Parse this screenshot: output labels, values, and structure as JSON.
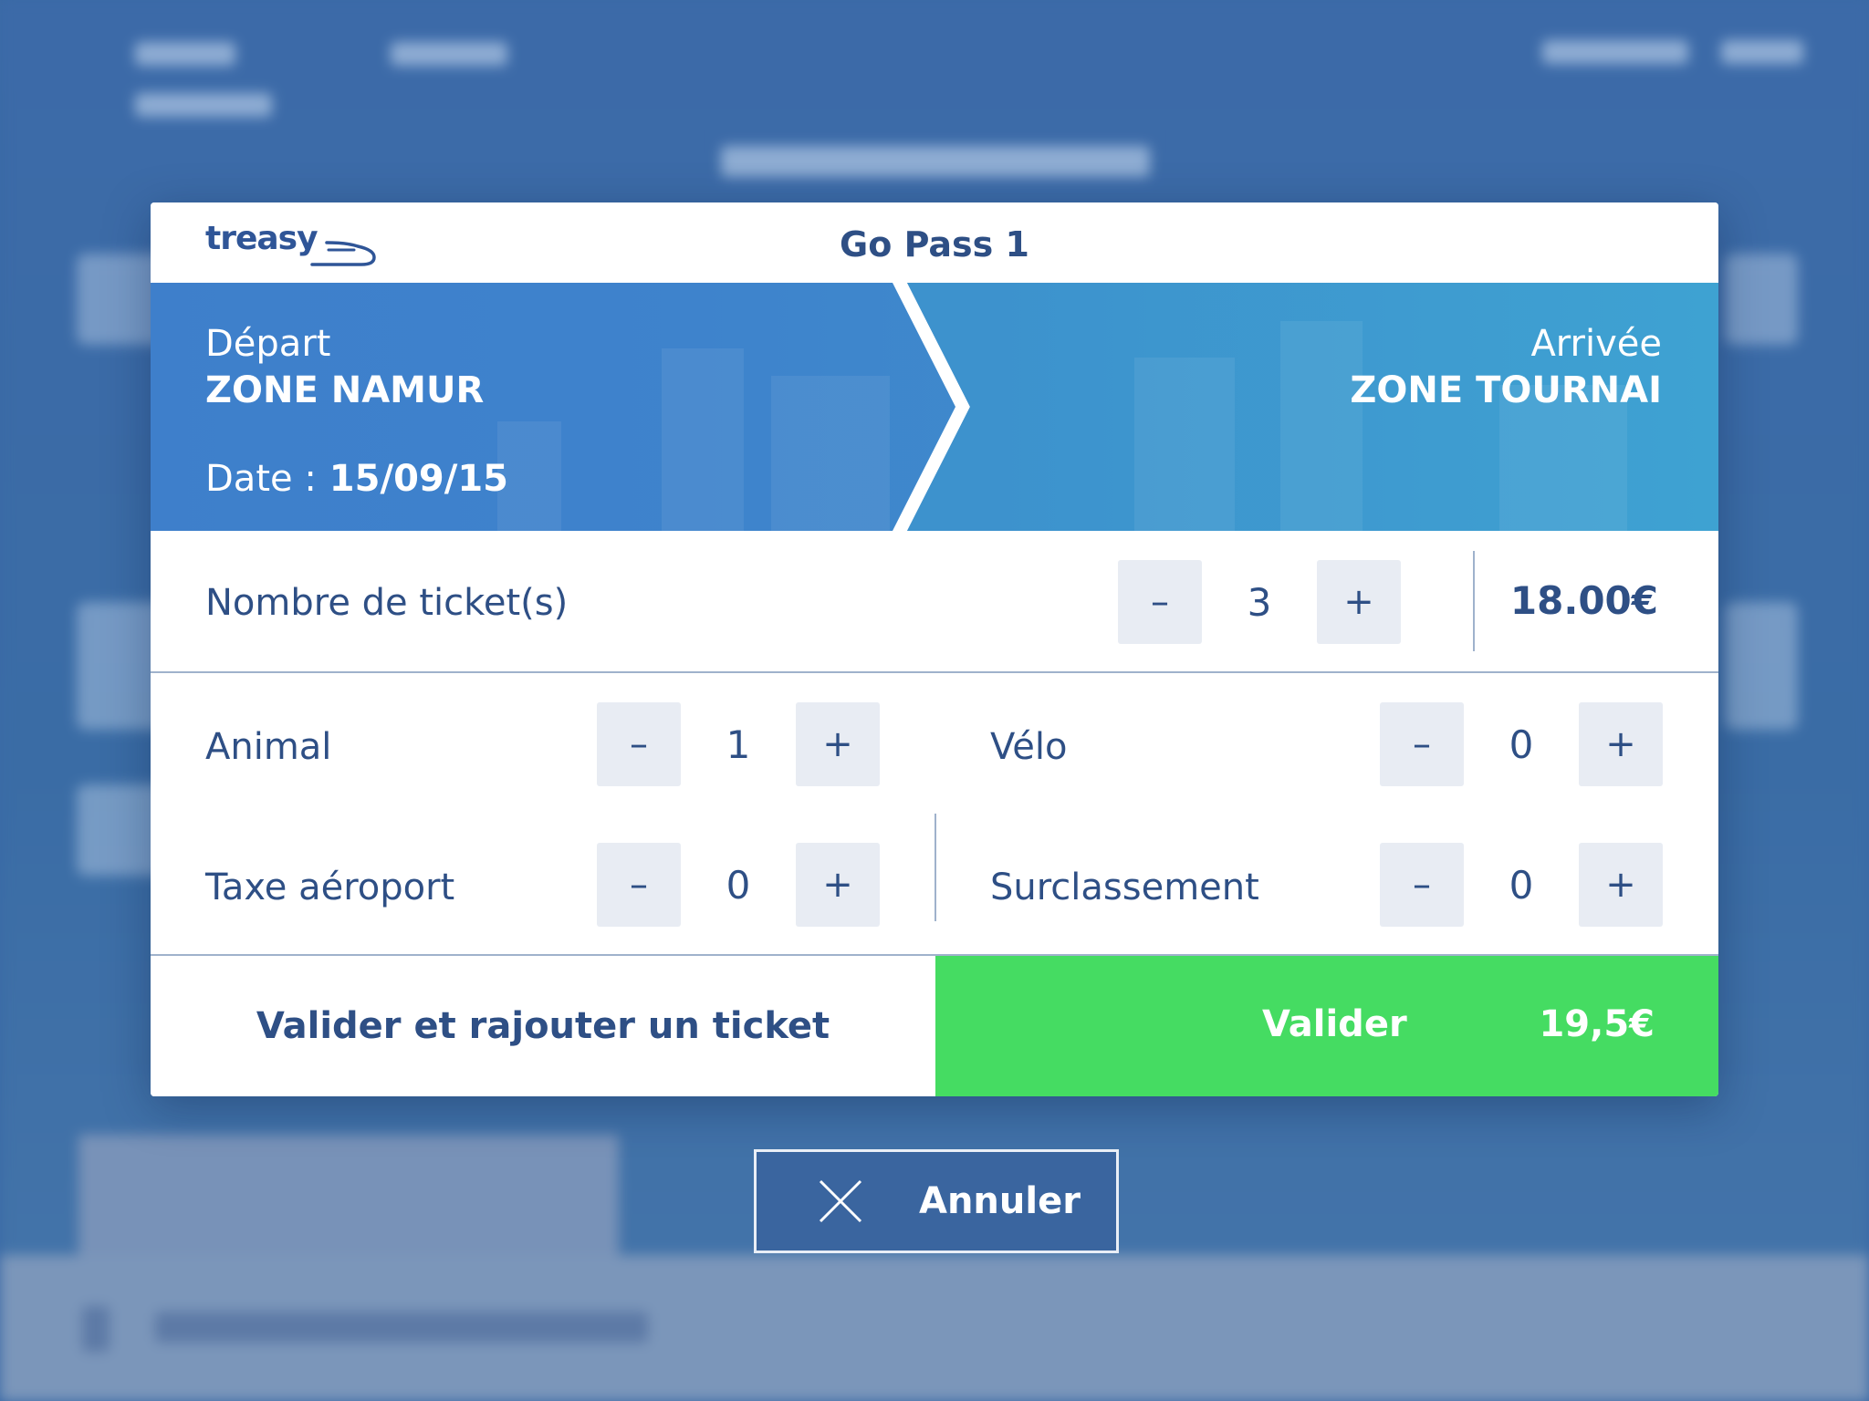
{
  "modal": {
    "logo_text": "treasy",
    "title": "Go Pass 1"
  },
  "route": {
    "depart_label": "Départ",
    "depart_zone": "ZONE NAMUR",
    "arrivee_label": "Arrivée",
    "arrivee_zone": "ZONE TOURNAI",
    "date_label": "Date :",
    "date_value": "15/09/15"
  },
  "tickets": {
    "label": "Nombre de ticket(s)",
    "minus": "–",
    "count": "3",
    "plus": "+",
    "price": "18.00€"
  },
  "options": [
    {
      "label": "Animal",
      "value": "1",
      "minus": "–",
      "plus": "+"
    },
    {
      "label": "Vélo",
      "value": "0",
      "minus": "–",
      "plus": "+"
    },
    {
      "label": "Taxe aéroport",
      "value": "0",
      "minus": "–",
      "plus": "+"
    },
    {
      "label": "Surclassement",
      "value": "0",
      "minus": "–",
      "plus": "+"
    }
  ],
  "actions": {
    "add_label": "Valider et rajouter un ticket",
    "validate_label": "Valider",
    "total": "19,5€"
  },
  "cancel": {
    "label": "Annuler"
  },
  "colors": {
    "brand_blue": "#2e4f85",
    "validate_green": "#45dc62",
    "stepper_bg": "#e8ecf3"
  }
}
